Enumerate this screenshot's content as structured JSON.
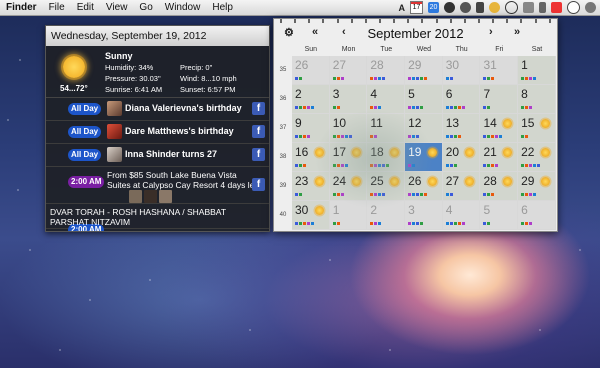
{
  "menubar": {
    "items": [
      "Finder",
      "File",
      "Edit",
      "View",
      "Go",
      "Window",
      "Help"
    ],
    "status": {
      "calendar_day": "17",
      "badge_day": "20"
    }
  },
  "panel": {
    "header": "Wednesday, September 19, 2012",
    "weather": {
      "condition": "Sunny",
      "temp_range": "54...72°",
      "humidity": "Humidity: 34%",
      "pressure": "Pressure: 30.03\"",
      "sunrise": "Sunrise: 6:41 AM",
      "precip": "Precip: 0\"",
      "wind": "Wind: 8...10 mph",
      "sunset": "Sunset: 6:57 PM"
    },
    "events": [
      {
        "chip": "All Day",
        "title": "Diana Valerievna's birthday"
      },
      {
        "chip": "All Day",
        "title": "Dare Matthews's birthday"
      },
      {
        "chip": "All Day",
        "title": "Inna Shinder turns 27"
      },
      {
        "chip": "2:00 AM",
        "title": "From $85 South Lake Buena Vista Suites at Calypso Cay Resort 4 days lef"
      },
      {
        "chip": "2:00 AM",
        "title": "DVAR TORAH - ROSH HASHANA / SHABBAT PARSHAT NITZAVIM"
      }
    ],
    "fb_label": "f"
  },
  "calendar": {
    "title": "September 2012",
    "nav": {
      "first": "⚙",
      "prev_year": "«",
      "prev_month": "‹",
      "next_month": "›",
      "next_year": "»"
    },
    "weekdays": [
      "Sun",
      "Mon",
      "Tue",
      "Wed",
      "Thu",
      "Fri",
      "Sat"
    ],
    "week_numbers": [
      "35",
      "36",
      "37",
      "38",
      "39",
      "40"
    ],
    "weeks": [
      [
        "26",
        "27",
        "28",
        "29",
        "30",
        "31",
        "1"
      ],
      [
        "2",
        "3",
        "4",
        "5",
        "6",
        "7",
        "8"
      ],
      [
        "9",
        "10",
        "11",
        "12",
        "13",
        "14",
        "15"
      ],
      [
        "16",
        "17",
        "18",
        "19",
        "20",
        "21",
        "22"
      ],
      [
        "23",
        "24",
        "25",
        "26",
        "27",
        "28",
        "29"
      ],
      [
        "30",
        "1",
        "2",
        "3",
        "4",
        "5",
        "6"
      ]
    ],
    "today": "19"
  }
}
